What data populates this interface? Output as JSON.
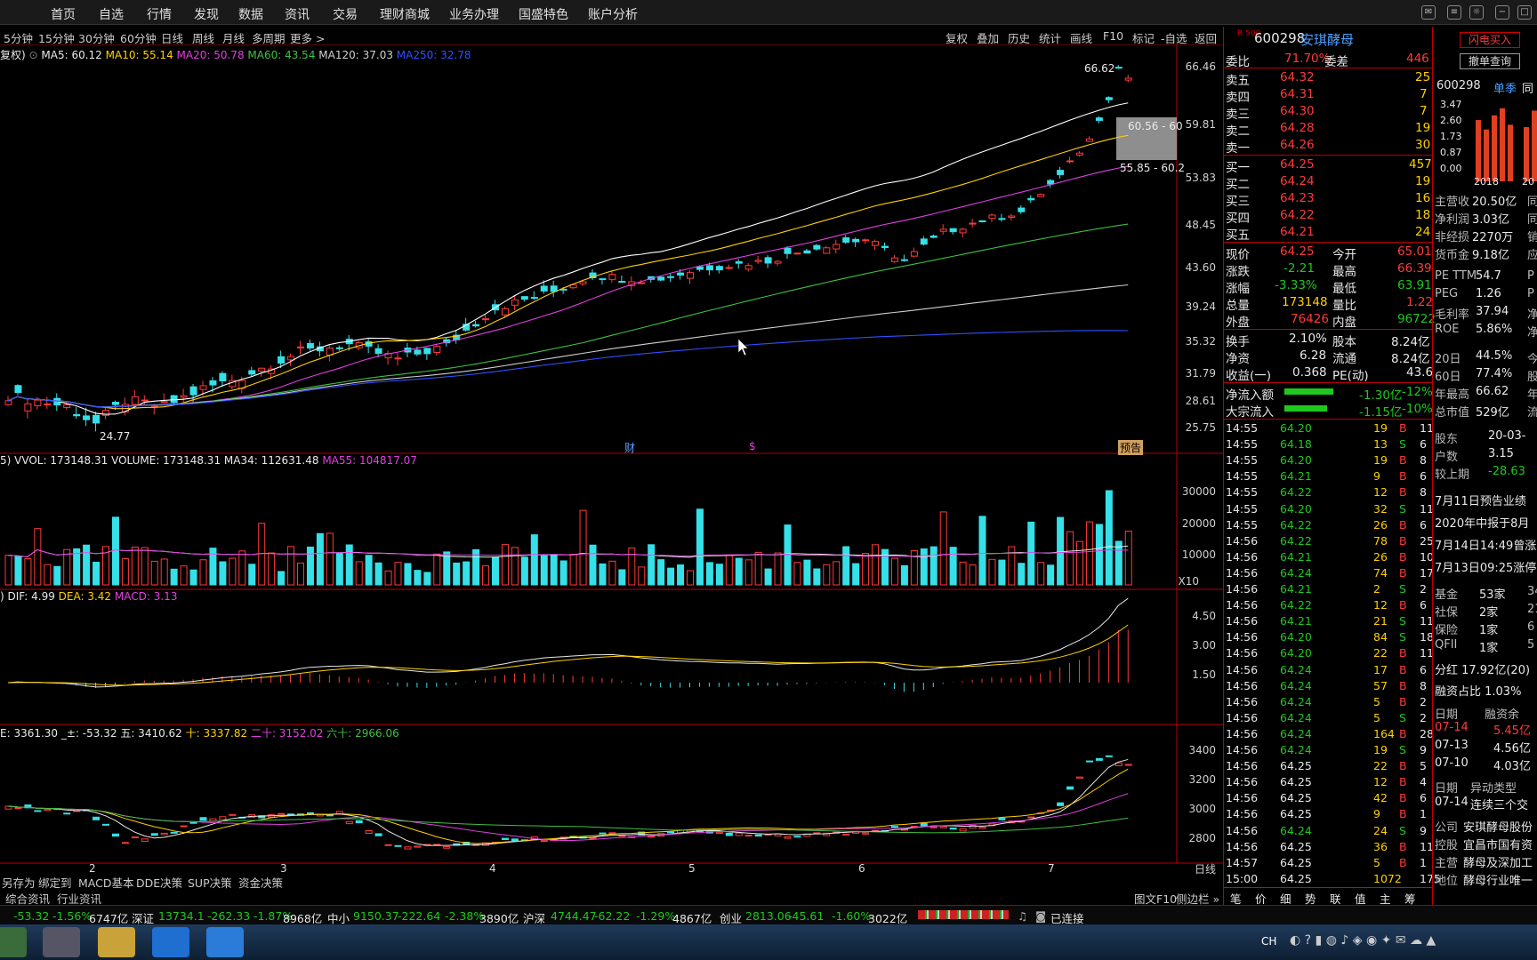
{
  "menu": {
    "items": [
      "首页",
      "自选",
      "行情",
      "发现",
      "数据",
      "资讯",
      "交易",
      "理财商城",
      "业务办理",
      "国盛特色",
      "账户分析"
    ]
  },
  "periods": {
    "items": [
      "5分钟",
      "15分钟",
      "30分钟",
      "60分钟",
      "日线",
      "周线",
      "月线",
      "多周期",
      "更多 >"
    ]
  },
  "tools": {
    "items": [
      "复权",
      "叠加",
      "历史",
      "统计",
      "画线",
      "F10",
      "标记",
      "-自选",
      "返回"
    ]
  },
  "legends": {
    "ma": {
      "prefix": "复权)",
      "ma5": "MA5: 60.12",
      "ma10": "MA10: 55.14",
      "ma20": "MA20: 50.78",
      "ma60": "MA60: 43.54",
      "ma120": "MA120: 37.03",
      "ma250": "MA250: 32.78"
    },
    "vol": {
      "prefix": "5)",
      "vvol": "VVOL: 173148.31",
      "volume": "VOLUME: 173148.31",
      "ma34": "MA34: 112631.48",
      "ma55": "MA55: 104817.07"
    },
    "macd": {
      "prefix": ")",
      "dif": "DIF: 4.99",
      "dea": "DEA: 3.42",
      "macd": "MACD: 3.13"
    },
    "idx": {
      "prefix": "E: 3361.30",
      "chg": "_±: -53.32",
      "five": "五: 3410.62",
      "ten": "十: 3337.82",
      "twenty": "二十: 3152.02",
      "sixty": "六十: 2966.06"
    }
  },
  "axis": {
    "price": [
      "66.46",
      "59.81",
      "53.83",
      "48.45",
      "43.60",
      "39.24",
      "35.32",
      "31.79",
      "28.61",
      "25.75"
    ],
    "vol": [
      "30000",
      "20000",
      "10000",
      "X10"
    ],
    "macd": [
      "4.50",
      "3.00",
      "1.50"
    ],
    "idx": [
      "3400",
      "3200",
      "3000",
      "2800"
    ],
    "period_label": "日线"
  },
  "chart_labels": {
    "high": "66.62",
    "low": "24.77",
    "range1": "60.56 - 60",
    "range2": "55.85 - 60.2",
    "cai": "财",
    "s": "$",
    "yugao": "预告"
  },
  "chart_data": {
    "type": "candlestick",
    "title": "600298 安琪酵母",
    "price_range": [
      24.5,
      67.0
    ],
    "x": [
      "2",
      "3",
      "4",
      "5",
      "6",
      "7"
    ],
    "ma_values": {
      "MA5": 60.12,
      "MA10": 55.14,
      "MA20": 50.78,
      "MA60": 43.54,
      "MA120": 37.03,
      "MA250": 32.78
    },
    "volume_last": 173148.31,
    "macd_last": {
      "DIF": 4.99,
      "DEA": 3.42,
      "MACD": 3.13
    },
    "index_last": {
      "close": 3361.3,
      "change": -53.32,
      "MA5": 3410.62,
      "MA10": 3337.82,
      "MA20": 3152.02,
      "MA60": 2966.06
    },
    "colors": {
      "up": "#ff3a3a",
      "down": "#35e0e8",
      "ma5": "#ffffff",
      "ma10": "#ffd000",
      "ma20": "#e040e0",
      "ma60": "#40c040",
      "ma120": "#d0d0d0",
      "ma250": "#3050ff"
    }
  },
  "bottom": {
    "tabs1": [
      "另存为",
      "绑定到",
      "MACD基本",
      "DDE决策",
      "SUP决策",
      "资金决策"
    ],
    "tabs2": [
      "综合资讯",
      "行业资讯"
    ],
    "f10": "图文F10",
    "side": "侧边栏 »"
  },
  "market": {
    "sh": [
      "-53.32",
      "-1.56%",
      "6747亿"
    ],
    "sz": [
      "深证",
      "13734.1",
      "-262.33",
      "-1.87%",
      "8968亿"
    ],
    "zx": [
      "中小",
      "9150.37",
      "-222.64",
      "-2.38%",
      "3890亿"
    ],
    "hs": [
      "沪深",
      "4744.47",
      "-62.22",
      "-1.29%",
      "4867亿"
    ],
    "cy": [
      "创业",
      "2813.06",
      "-45.61",
      "-1.60%",
      "3022亿"
    ],
    "conn": "已连接"
  },
  "quote": {
    "code": "600298",
    "name": "安琪酵母",
    "tag": "R 500",
    "weibi": [
      "委比",
      "71.70%",
      "委差",
      "446"
    ],
    "asks": [
      [
        "卖五",
        "64.32",
        "25"
      ],
      [
        "卖四",
        "64.31",
        "7"
      ],
      [
        "卖三",
        "64.30",
        "7"
      ],
      [
        "卖二",
        "64.28",
        "19"
      ],
      [
        "卖一",
        "64.26",
        "30"
      ]
    ],
    "bids": [
      [
        "买一",
        "64.25",
        "457"
      ],
      [
        "买二",
        "64.24",
        "19"
      ],
      [
        "买三",
        "64.23",
        "16"
      ],
      [
        "买四",
        "64.22",
        "18"
      ],
      [
        "买五",
        "64.21",
        "24"
      ]
    ],
    "stats": [
      [
        "现价",
        "64.25",
        "今开",
        "65.01"
      ],
      [
        "涨跌",
        "-2.21",
        "最高",
        "66.39"
      ],
      [
        "涨幅",
        "-3.33%",
        "最低",
        "63.91"
      ],
      [
        "总量",
        "173148",
        "量比",
        "1.22"
      ],
      [
        "外盘",
        "76426",
        "内盘",
        "96722"
      ]
    ],
    "stats2": [
      [
        "换手",
        "2.10%",
        "股本",
        "8.24亿"
      ],
      [
        "净资",
        "6.28",
        "流通",
        "8.24亿"
      ],
      [
        "收益(一)",
        "0.368",
        "PE(动)",
        "43.6"
      ]
    ],
    "flow": [
      [
        "净流入额",
        "-1.30亿",
        "-12%"
      ],
      [
        "大宗流入",
        "-1.15亿",
        "-10%"
      ]
    ],
    "ticks": [
      [
        "14:55",
        "64.20",
        "19",
        "B",
        "11"
      ],
      [
        "14:55",
        "64.18",
        "13",
        "S",
        "6"
      ],
      [
        "14:55",
        "64.20",
        "19",
        "B",
        "8"
      ],
      [
        "14:55",
        "64.21",
        "9",
        "B",
        "6"
      ],
      [
        "14:55",
        "64.22",
        "12",
        "B",
        "8"
      ],
      [
        "14:55",
        "64.20",
        "32",
        "S",
        "11"
      ],
      [
        "14:55",
        "64.22",
        "26",
        "B",
        "6"
      ],
      [
        "14:56",
        "64.22",
        "78",
        "B",
        "25"
      ],
      [
        "14:56",
        "64.21",
        "26",
        "B",
        "10"
      ],
      [
        "14:56",
        "64.24",
        "74",
        "B",
        "17"
      ],
      [
        "14:56",
        "64.21",
        "2",
        "S",
        "2"
      ],
      [
        "14:56",
        "64.22",
        "12",
        "B",
        "6"
      ],
      [
        "14:56",
        "64.21",
        "21",
        "S",
        "11"
      ],
      [
        "14:56",
        "64.20",
        "84",
        "S",
        "18"
      ],
      [
        "14:56",
        "64.20",
        "22",
        "B",
        "11"
      ],
      [
        "14:56",
        "64.24",
        "17",
        "B",
        "6"
      ],
      [
        "14:56",
        "64.24",
        "57",
        "B",
        "8"
      ],
      [
        "14:56",
        "64.24",
        "5",
        "B",
        "2"
      ],
      [
        "14:56",
        "64.24",
        "5",
        "S",
        "2"
      ],
      [
        "14:56",
        "64.24",
        "164",
        "B",
        "28"
      ],
      [
        "14:56",
        "64.24",
        "19",
        "S",
        "9"
      ],
      [
        "14:56",
        "64.25",
        "22",
        "B",
        "5"
      ],
      [
        "14:56",
        "64.25",
        "12",
        "B",
        "4"
      ],
      [
        "14:56",
        "64.25",
        "42",
        "B",
        "6"
      ],
      [
        "14:56",
        "64.25",
        "9",
        "B",
        "1"
      ],
      [
        "14:56",
        "64.24",
        "24",
        "S",
        "9"
      ],
      [
        "14:56",
        "64.25",
        "36",
        "B",
        "11"
      ],
      [
        "14:57",
        "64.25",
        "5",
        "B",
        "1"
      ],
      [
        "15:00",
        "64.25",
        "1072",
        "",
        "175"
      ]
    ],
    "tabs": [
      "笔",
      "价",
      "细",
      "势",
      "联",
      "值",
      "主",
      "筹"
    ]
  },
  "info": {
    "btn_buy": "闪电买入",
    "btn_query": "撤单查询",
    "code": "600298",
    "season": "单季",
    "tong": "同",
    "yaxis": [
      "3.47",
      "2.60",
      "1.73",
      "0.87",
      "0.00"
    ],
    "years": [
      "2018",
      "20"
    ],
    "bars": [
      2.6,
      2.2,
      2.8,
      3.1,
      2.4,
      0.0,
      2.3,
      3.0
    ],
    "rows": [
      [
        "主营收",
        "20.50亿",
        "同"
      ],
      [
        "净利润",
        "3.03亿",
        "同"
      ],
      [
        "非经损",
        "2270万",
        "销"
      ],
      [
        "货币金",
        "9.18亿",
        "应"
      ],
      [
        "PE TTM",
        "54.7",
        "P"
      ],
      [
        "PEG",
        "1.26",
        "P"
      ],
      [
        "毛利率",
        "37.94",
        "净"
      ],
      [
        "ROE",
        "5.86%",
        "净"
      ],
      [
        "20日",
        "44.5%",
        "今"
      ],
      [
        "60日",
        "77.4%",
        "股"
      ],
      [
        "年最高",
        "66.62",
        "年"
      ],
      [
        "总市值",
        "529亿",
        "流"
      ],
      [
        "股东",
        "20-03-",
        "",
        ""
      ],
      [
        "户数",
        "3.15",
        ""
      ],
      [
        "较上期",
        "-28.63",
        ""
      ]
    ],
    "news": [
      "7月11日预告业绩",
      "2020年中报于8月",
      "7月14日14:49曾涨",
      "7月13日09:25涨停"
    ],
    "holders": [
      [
        "基金",
        "53家",
        "34"
      ],
      [
        "社保",
        "2家",
        "21"
      ],
      [
        "保险",
        "1家",
        "6"
      ],
      [
        "QFII",
        "1家",
        "5"
      ]
    ],
    "fh": "分红 17.92亿(20)",
    "rz": "融资占比 1.03%",
    "rzhead": [
      "日期",
      "融资余"
    ],
    "rzrows": [
      [
        "07-14",
        "5.45亿"
      ],
      [
        "07-13",
        "4.56亿"
      ],
      [
        "07-10",
        "4.03亿"
      ]
    ],
    "ydhead": [
      "日期",
      "异动类型"
    ],
    "ydrow": [
      "07-14",
      "连续三个交"
    ],
    "company": [
      [
        "公司",
        "安琪酵母股份"
      ],
      [
        "控股",
        "宜昌市国有资"
      ],
      [
        "主营",
        "酵母及深加工"
      ],
      [
        "地位",
        "酵母行业唯一"
      ]
    ]
  }
}
